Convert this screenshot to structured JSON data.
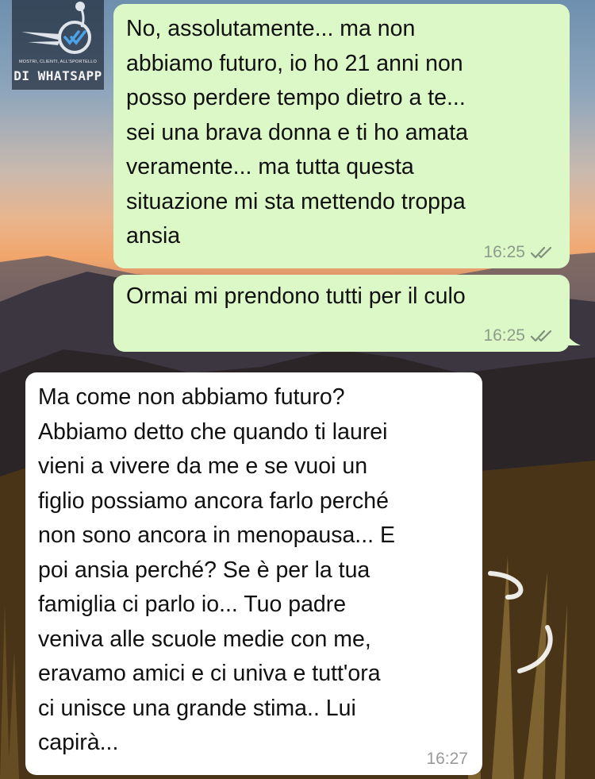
{
  "watermark": {
    "tagline": "Mostri, clienti, all'sportello",
    "name": "DI WHATSAPP"
  },
  "messages": [
    {
      "direction": "outgoing",
      "text": "No, assolutamente... ma non\nabbiamo futuro, io ho 21 anni non\nposso perdere tempo dietro a te...\nsei una brava donna e ti ho amata\nveramente... ma tutta questa\nsituazione mi sta mettendo troppa\nansia",
      "time": "16:25",
      "status_icon": "double-check-icon"
    },
    {
      "direction": "outgoing",
      "text": "Ormai mi prendono tutti per il culo",
      "time": "16:25",
      "status_icon": "double-check-icon"
    },
    {
      "direction": "incoming",
      "text": "Ma come non abbiamo futuro?\nAbbiamo detto che quando ti laurei\nvieni a vivere da me e se vuoi un\nfiglio possiamo ancora farlo perché\nnon sono ancora in menopausa... E\npoi ansia perché?  Se è per la tua\nfamiglia ci parlo io...  Tuo padre\nveniva alle scuole medie con me,\neravamo amici e ci univa e tutt'ora\nci unisce una grande stima.. Lui\ncapirà...",
      "time": "16:27"
    }
  ],
  "colors": {
    "outgoing_bubble": "#dcf8c6",
    "incoming_bubble": "#ffffff",
    "check_marks": "#8e9b8a"
  }
}
